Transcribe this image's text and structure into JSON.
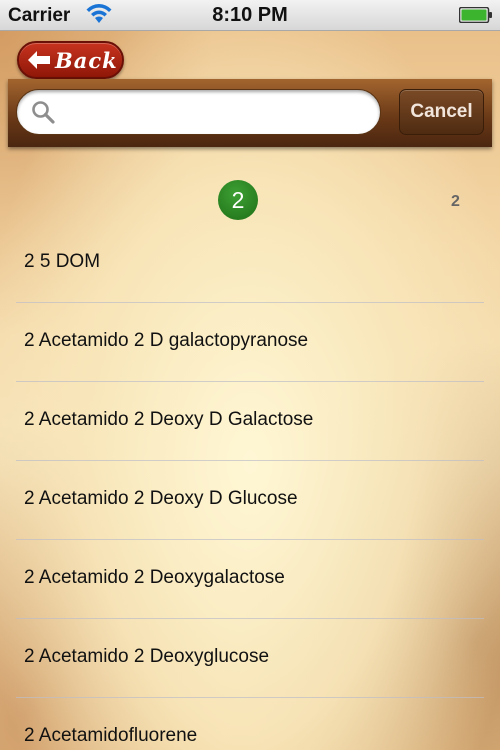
{
  "status_bar": {
    "carrier": "Carrier",
    "time": "8:10 PM",
    "wifi_icon": "wifi-icon",
    "battery_icon": "battery-full-icon"
  },
  "nav": {
    "back_label": "Back",
    "back_icon": "arrow-left-icon"
  },
  "search": {
    "value": "",
    "placeholder": "",
    "cancel_label": "Cancel",
    "icon": "search-icon"
  },
  "section": {
    "badge": "2",
    "index_letter": "2",
    "badge_color": "#2a8a20"
  },
  "list": {
    "items": [
      "2 5 DOM",
      "2 Acetamido 2 D galactopyranose",
      "2 Acetamido 2 Deoxy D Galactose",
      "2 Acetamido 2 Deoxy D Glucose",
      "2 Acetamido 2 Deoxygalactose",
      "2 Acetamido 2 Deoxyglucose",
      "2 Acetamidofluorene"
    ]
  },
  "colors": {
    "back_button": "#b02a16",
    "search_bar": "#7a4520",
    "cancel_button": "#5e3517"
  }
}
